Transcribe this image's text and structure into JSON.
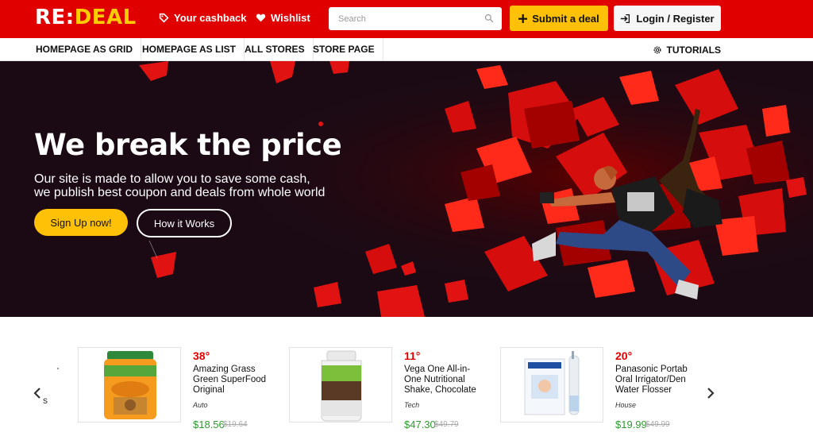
{
  "header": {
    "logo_part1": "RE:",
    "logo_part2": "DEAL",
    "cashback_label": "Your cashback",
    "wishlist_label": "Wishlist",
    "search_placeholder": "Search",
    "submit_label": "Submit a deal",
    "login_label": "Login / Register"
  },
  "nav": {
    "items": [
      {
        "label": "HOMEPAGE AS GRID"
      },
      {
        "label": "HOMEPAGE AS LIST"
      },
      {
        "label": "ALL STORES"
      },
      {
        "label": "STORE PAGE"
      }
    ],
    "tutorials_label": "TUTORIALS"
  },
  "hero": {
    "title": "We break the price",
    "subtitle_line1": "Our site is made to allow you to save some cash,",
    "subtitle_line2": "we publish best coupon and deals from whole world",
    "signup_label": "Sign Up now!",
    "how_label": "How it Works"
  },
  "deals": {
    "prev_fragment": "s",
    "items": [
      {
        "percent": "38°",
        "title_l1": "Amazing Grass",
        "title_l2": "Green SuperFood",
        "title_l3": "Original",
        "category": "Auto",
        "price": "$18.56",
        "old_price": "$19.64"
      },
      {
        "percent": "11°",
        "title_l1": "Vega One All-in-",
        "title_l2": "One Nutritional",
        "title_l3": "Shake, Chocolate",
        "category": "Tech",
        "price": "$47.30",
        "old_price": "$49.79"
      },
      {
        "percent": "20°",
        "title_l1": "Panasonic Portab",
        "title_l2": "Oral Irrigator/Den",
        "title_l3": "Water Flosser",
        "category": "House",
        "price": "$19.99",
        "old_price": "$49.99"
      }
    ]
  },
  "colors": {
    "brand_red": "#e00000",
    "accent_yellow": "#ffc107",
    "hero_bg": "#1b0a14",
    "price_green": "#2e9a2e"
  }
}
